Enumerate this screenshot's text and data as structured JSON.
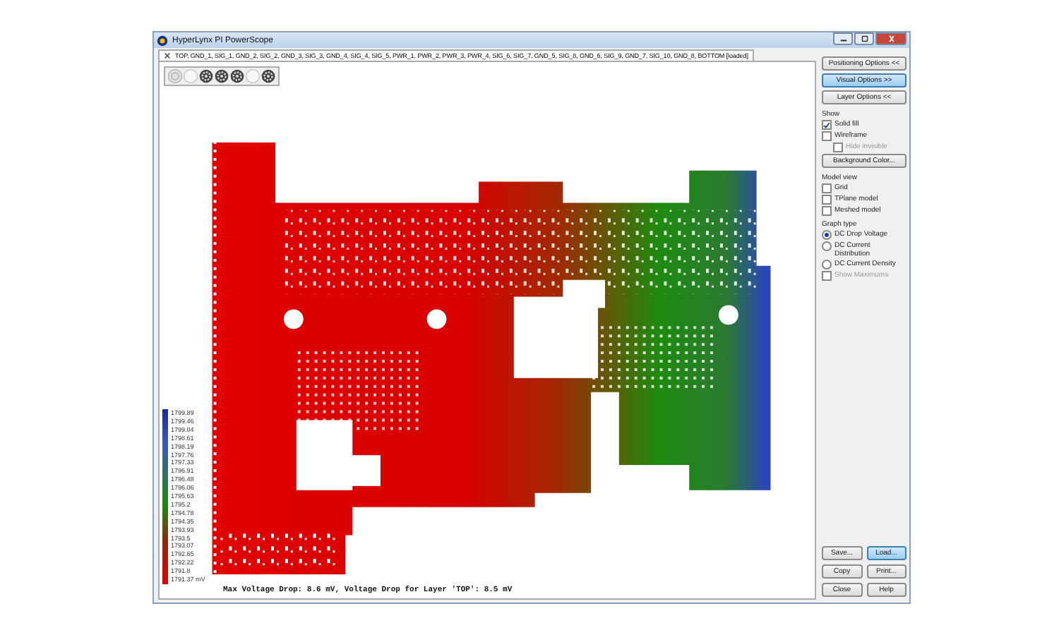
{
  "window": {
    "title": "HyperLynx PI PowerScope"
  },
  "tab": {
    "label": "TOP, GND_1, SIG_1, GND_2, SIG_2, GND_3, SIG_3, GND_4, SIG_4, SIG_5, PWR_1, PWR_2, PWR_3, PWR_4, SIG_6, SIG_7, GND_5, SIG_8, GND_6, SIG_9, GND_7, SIG_10, GND_8, BOTTOM [loaded]"
  },
  "toolbar": [
    {
      "kind": "disabled"
    },
    {
      "kind": "blank"
    },
    {
      "kind": "icon"
    },
    {
      "kind": "icon"
    },
    {
      "kind": "icon"
    },
    {
      "kind": "blank"
    },
    {
      "kind": "icon"
    }
  ],
  "legend": {
    "labels": [
      "1799.89",
      "1799.46",
      "1799.04",
      "1798.61",
      "1798.19",
      "1797.76",
      "1797.33",
      "1796.91",
      "1796.48",
      "1796.06",
      "1795.63",
      "1795.2",
      "1794.78",
      "1794.35",
      "1793.93",
      "1793.5",
      "1793.07",
      "1792.65",
      "1792.22",
      "1791.8",
      "1791.37 mV"
    ]
  },
  "status": "Max Voltage Drop: 8.6 mV, Voltage Drop for Layer 'TOP': 8.5 mV",
  "panel": {
    "options": [
      {
        "label": "Positioning Options <<",
        "selected": false
      },
      {
        "label": "Visual Options >>",
        "selected": true
      },
      {
        "label": "Layer Options <<",
        "selected": false
      }
    ],
    "show_label": "Show",
    "show": [
      {
        "label": "Solid fill",
        "checked": true,
        "disabled": false,
        "indented": false
      },
      {
        "label": "Wireframe",
        "checked": false,
        "disabled": false,
        "indented": false
      },
      {
        "label": "Hide invisible",
        "checked": false,
        "disabled": true,
        "indented": true
      }
    ],
    "background_button": "Background Color...",
    "model_label": "Model view",
    "model": [
      {
        "label": "Grid",
        "checked": false,
        "disabled": false,
        "indented": false
      },
      {
        "label": "TPlane model",
        "checked": false,
        "disabled": false,
        "indented": false
      },
      {
        "label": "Meshed model",
        "checked": false,
        "disabled": false,
        "indented": false
      }
    ],
    "graph_label": "Graph type",
    "graph": [
      {
        "label": "DC Drop Voltage",
        "selected": true
      },
      {
        "label": "DC Current Distribution",
        "selected": false
      },
      {
        "label": "DC Current Density",
        "selected": false
      }
    ],
    "maximums": {
      "label": "Show Maximums",
      "checked": false,
      "disabled": true,
      "indented": false
    },
    "buttons": [
      {
        "label": "Save...",
        "selected": false
      },
      {
        "label": "Load...",
        "selected": true
      },
      {
        "label": "Copy",
        "selected": false
      },
      {
        "label": "Print...",
        "selected": false
      },
      {
        "label": "Close",
        "selected": false
      },
      {
        "label": "Help",
        "selected": false
      }
    ]
  }
}
